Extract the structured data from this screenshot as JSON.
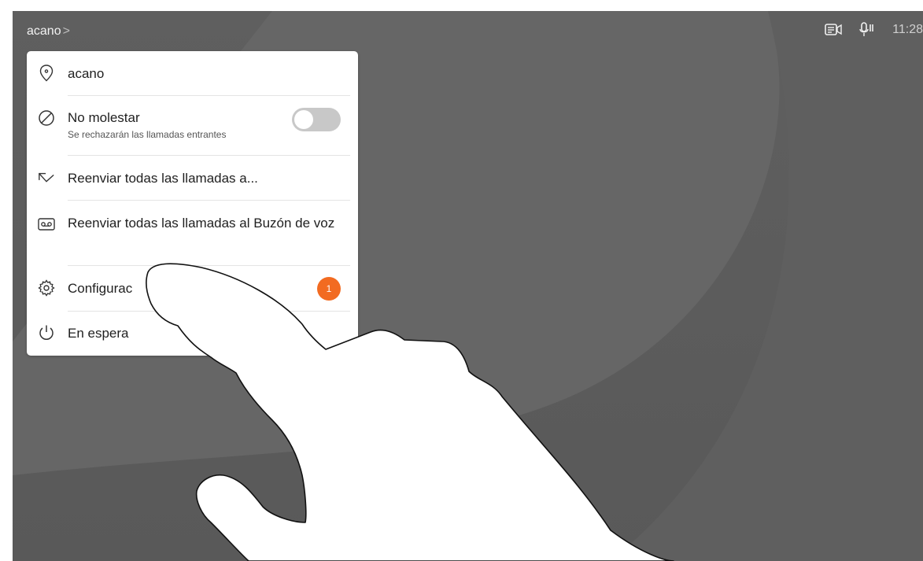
{
  "header": {
    "title": "acano",
    "chevron": ">"
  },
  "status": {
    "time": "11:28",
    "icons": [
      "screen-share-icon",
      "microphone-icon"
    ]
  },
  "menu": {
    "items": [
      {
        "icon": "location-pin-icon",
        "label": "acano"
      },
      {
        "icon": "do-not-disturb-icon",
        "label": "No molestar",
        "sublabel": "Se rechazarán las llamadas entrantes",
        "toggle_on": false
      },
      {
        "icon": "forward-arrow-icon",
        "label": "Reenviar todas las llamadas a..."
      },
      {
        "icon": "voicemail-icon",
        "label": "Reenviar todas las llamadas al Buzón de voz"
      },
      {
        "icon": "gear-icon",
        "label": "Configurac",
        "badge": "1"
      },
      {
        "icon": "power-icon",
        "label": "En espera"
      }
    ]
  },
  "colors": {
    "background": "#5e5e5e",
    "badge": "#f26b21",
    "panel": "#ffffff"
  }
}
